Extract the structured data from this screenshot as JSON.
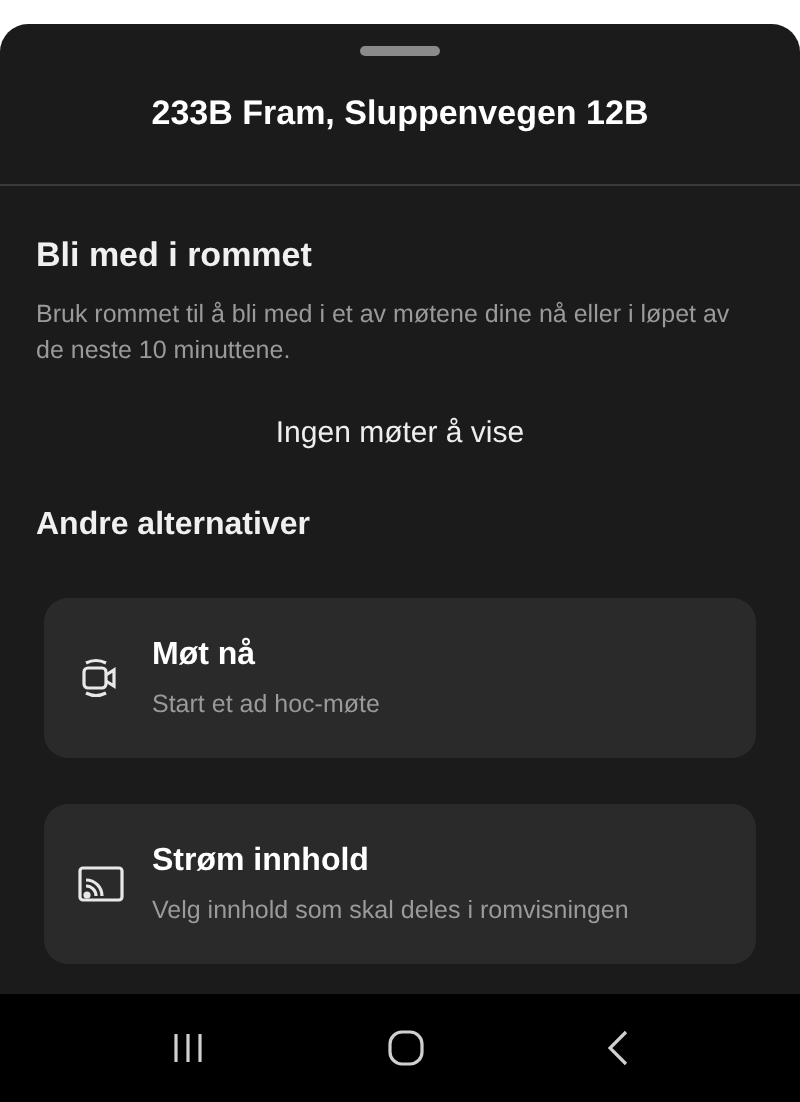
{
  "sheet": {
    "title": "233B Fram, Sluppenvegen 12B"
  },
  "join": {
    "heading": "Bli med i rommet",
    "description": "Bruk rommet til å bli med i et av møtene dine nå eller i løpet av de neste 10 minuttene.",
    "empty_message": "Ingen møter å vise"
  },
  "alternatives": {
    "heading": "Andre alternativer",
    "options": [
      {
        "kind": "meet",
        "title": "Møt nå",
        "subtitle": "Start et ad hoc-møte"
      },
      {
        "kind": "cast",
        "title": "Strøm innhold",
        "subtitle": "Velg innhold som skal deles i romvisningen"
      }
    ]
  },
  "nav_bar": {
    "buttons": [
      {
        "kind": "recents"
      },
      {
        "kind": "home"
      },
      {
        "kind": "back"
      }
    ]
  }
}
